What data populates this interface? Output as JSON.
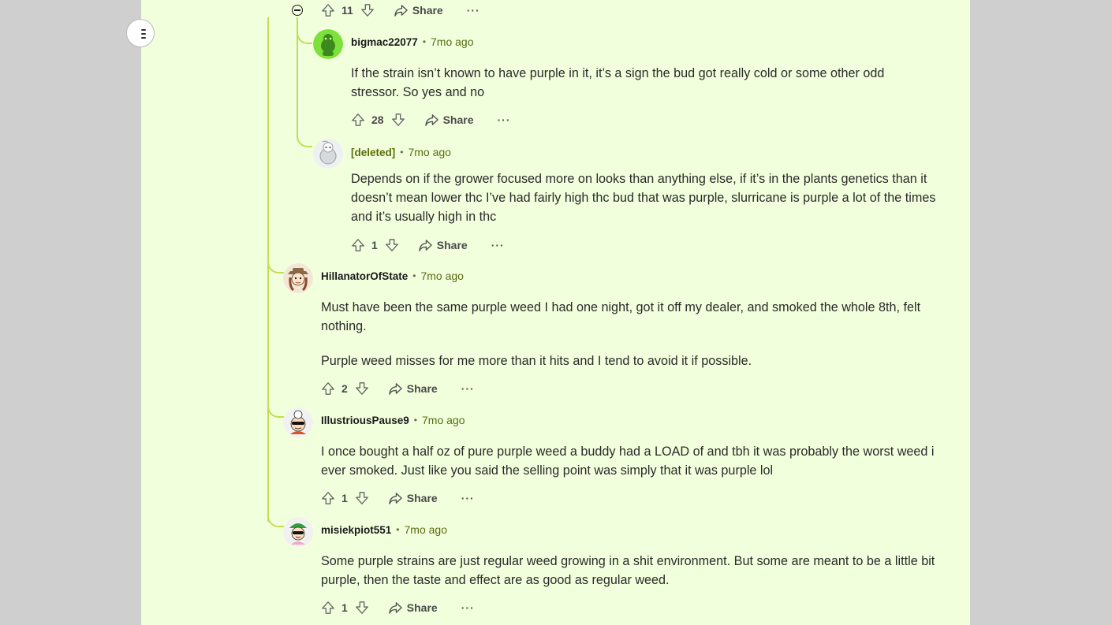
{
  "top_actions": {
    "count": "11",
    "share": "Share",
    "more": "···"
  },
  "comments": [
    {
      "user": "bigmac22077",
      "sep": "•",
      "time": "7mo ago",
      "paragraphs": [
        "If the strain isn’t known to have purple in it, it’s a sign the bud got really cold or some other odd stressor. So yes and no"
      ],
      "votes": "28",
      "share": "Share",
      "more": "···"
    },
    {
      "user": "[deleted]",
      "sep": "•",
      "time": "7mo ago",
      "paragraphs": [
        "Depends on if the grower focused more on looks than anything else, if it’s in the plants genetics than it doesn’t mean lower thc I’ve had fairly high thc bud that was purple, slurricane is purple a lot of the times and it’s usually high in thc"
      ],
      "votes": "1",
      "share": "Share",
      "more": "···"
    },
    {
      "user": "HillanatorOfState",
      "sep": "•",
      "time": "7mo ago",
      "paragraphs": [
        "Must have been the same purple weed I had one night, got it off my dealer, and smoked the whole 8th, felt nothing.",
        "Purple weed misses for me more than it hits and I tend to avoid it if possible."
      ],
      "votes": "2",
      "share": "Share",
      "more": "···"
    },
    {
      "user": "IllustriousPause9",
      "sep": "•",
      "time": "7mo ago",
      "paragraphs": [
        "I once bought a half oz of pure purple weed a buddy had a LOAD of and tbh it was probably the worst weed i ever smoked. Just like you said the selling point was simply that it was purple lol"
      ],
      "votes": "1",
      "share": "Share",
      "more": "···"
    },
    {
      "user": "misiekpiot551",
      "sep": "•",
      "time": "7mo ago",
      "paragraphs": [
        "Some purple strains are just regular weed growing in a shit environment. But some are meant to be a little bit purple, then the taste and effect are as good as regular weed."
      ],
      "votes": "1",
      "share": "Share",
      "more": "···"
    }
  ],
  "colors": {
    "background": "#f2ffdc",
    "thread_line": "#c5dc52",
    "username_deleted": "#5a6d07",
    "timestamp": "#5b6b0f"
  },
  "icons": [
    "menu-icon",
    "collapse-icon",
    "upvote-icon",
    "downvote-icon",
    "share-icon",
    "more-icon",
    "avatar"
  ]
}
